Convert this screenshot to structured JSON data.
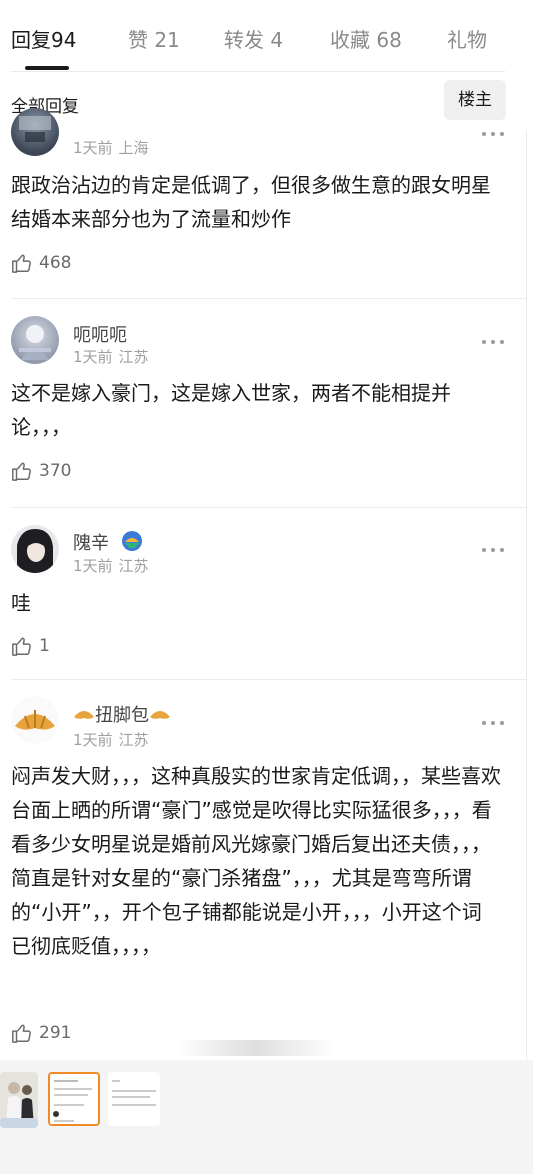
{
  "tabs": [
    {
      "label": "回复",
      "count": "94"
    },
    {
      "label": "赞",
      "count": "21"
    },
    {
      "label": "转发",
      "count": "4"
    },
    {
      "label": "收藏",
      "count": "68"
    },
    {
      "label": "礼物",
      "count": ""
    }
  ],
  "filter": {
    "label": "全部回复",
    "chip": "楼主"
  },
  "comments": [
    {
      "name": "",
      "time": "1天前",
      "location": "上海",
      "text": "跟政治沾边的肯定是低调了，但很多做生意的跟女明星结婚本来部分也为了流量和炒作",
      "likes": "468"
    },
    {
      "name": "呃呃呃",
      "time": "1天前",
      "location": "江苏",
      "text": "这不是嫁入豪门，这是嫁入世家，两者不能相提并论，，，",
      "likes": "370"
    },
    {
      "name": "隗辛",
      "time": "1天前",
      "location": "江苏",
      "text": "哇",
      "likes": "1"
    },
    {
      "name": "扭脚包",
      "time": "1天前",
      "location": "江苏",
      "text": "闷声发大财，，，这种真殷实的世家肯定低调，，某些喜欢台面上晒的所谓“豪门”感觉是吹得比实际猛很多，，，看看多少女明星说是婚前风光嫁豪门婚后复出还夫债，，，简直是针对女星的“豪门杀猪盘”，，，尤其是弯弯所谓的“小开”，，开个包子铺都能说是小开，，，小开这个词已彻底贬值，，，，",
      "likes": "291"
    }
  ],
  "colors": {
    "selected_thumb": "#f08a24",
    "text": "#1a1a1a",
    "muted": "#a0a0a0"
  }
}
